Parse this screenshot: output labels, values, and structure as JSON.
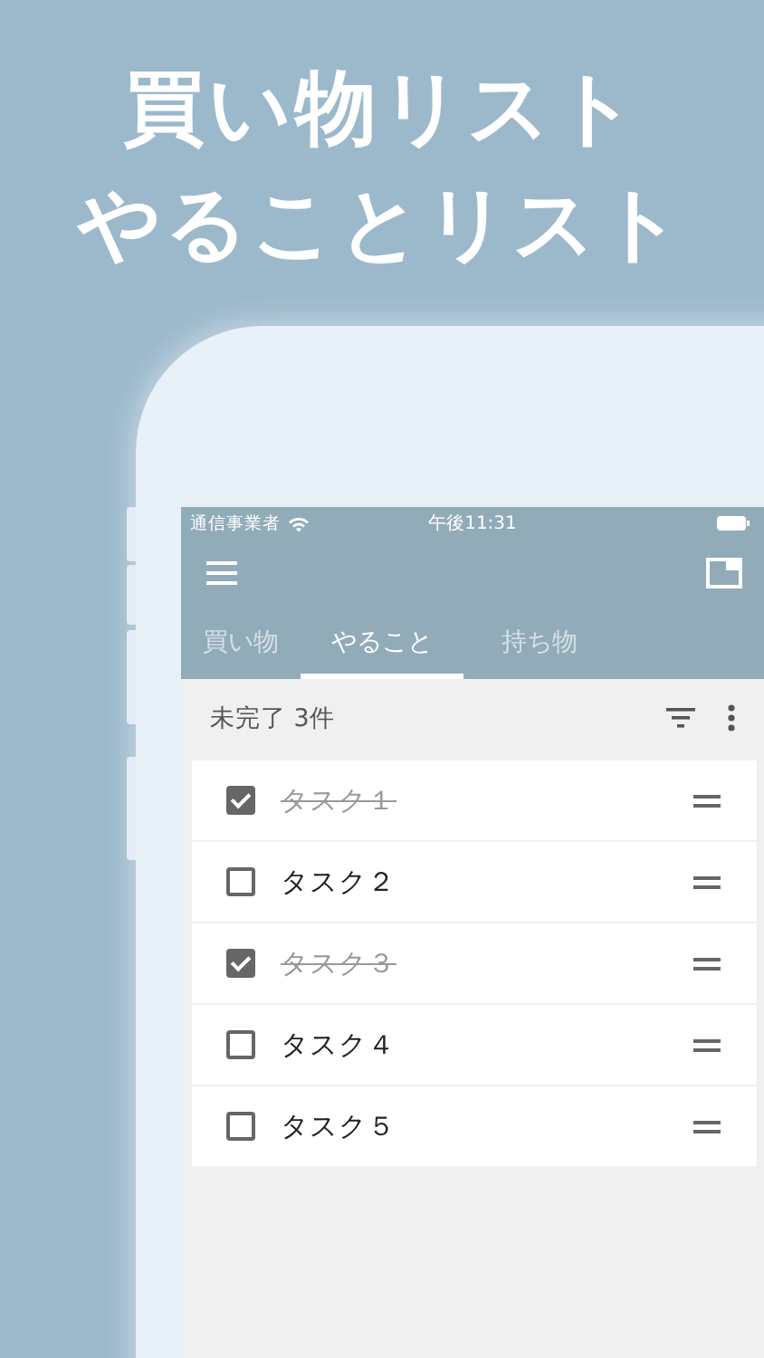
{
  "headline": [
    "買い物リスト",
    "やることリスト"
  ],
  "status_bar": {
    "carrier": "通信事業者",
    "time": "午後11:31"
  },
  "tabs": [
    {
      "label": "買い物",
      "selected": false
    },
    {
      "label": "やること",
      "selected": true
    },
    {
      "label": "持ち物",
      "selected": false
    }
  ],
  "summary": "未完了 3件",
  "tasks": [
    {
      "label": "タスク１",
      "checked": true
    },
    {
      "label": "タスク２",
      "checked": false
    },
    {
      "label": "タスク３",
      "checked": true
    },
    {
      "label": "タスク４",
      "checked": false
    },
    {
      "label": "タスク５",
      "checked": false
    }
  ]
}
